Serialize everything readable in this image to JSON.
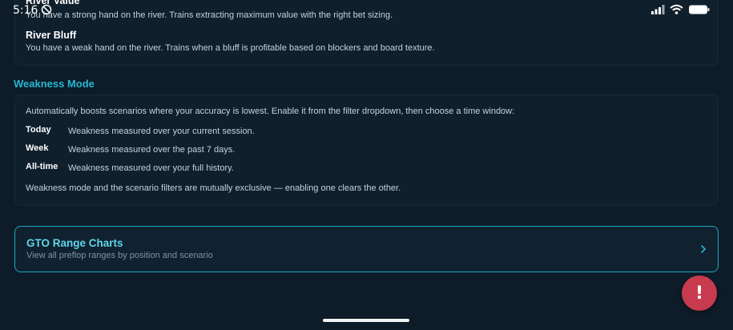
{
  "status_bar": {
    "time": "5:16"
  },
  "training_modes": [
    {
      "title": "River Value",
      "description": "You have a strong hand on the river. Trains extracting maximum value with the right bet sizing."
    },
    {
      "title": "River Bluff",
      "description": "You have a weak hand on the river. Trains when a bluff is profitable based on blockers and board texture."
    }
  ],
  "weakness_mode": {
    "heading": "Weakness Mode",
    "intro": "Automatically boosts scenarios where your accuracy is lowest. Enable it from the filter dropdown, then choose a time window:",
    "windows": [
      {
        "label": "Today",
        "description": "Weakness measured over your current session."
      },
      {
        "label": "Week",
        "description": "Weakness measured over the past 7 days."
      },
      {
        "label": "All-time",
        "description": "Weakness measured over your full history."
      }
    ],
    "footnote": "Weakness mode and the scenario filters are mutually exclusive — enabling one clears the other."
  },
  "range_charts_link": {
    "title": "GTO Range Charts",
    "subtitle": "View all preflop ranges by position and scenario"
  },
  "feedback_button": {
    "label": "!"
  },
  "colors": {
    "background": "#0d1c28",
    "accent": "#27b7d0",
    "link_title": "#5fd6ea",
    "fab": "#c83a4e"
  },
  "icons": {
    "dnd": "do-not-disturb-icon",
    "signal": "signal-icon",
    "wifi": "wifi-icon",
    "battery": "battery-icon",
    "chevron": "chevron-right-icon"
  }
}
